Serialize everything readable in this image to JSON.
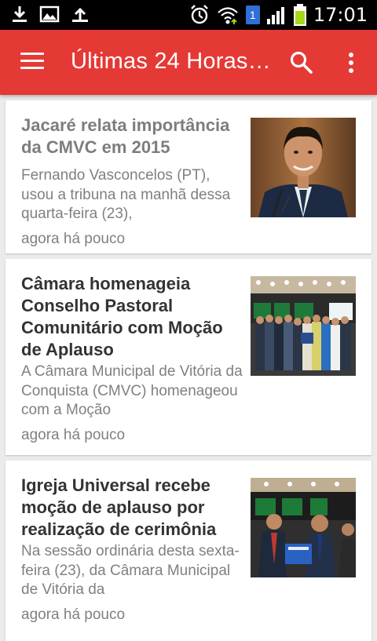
{
  "status_bar": {
    "time": "17:01",
    "notification_count": "1",
    "icons": [
      "download-icon",
      "image-icon",
      "upload-icon",
      "alarm-icon",
      "wifi-icon",
      "signal-icon",
      "battery-icon"
    ],
    "battery_color": "#a5d81c"
  },
  "app_bar": {
    "title": "Últimas 24 Horas…",
    "color": "#e53935",
    "menu_icon": "hamburger-menu-icon",
    "search_icon": "search-icon",
    "overflow_icon": "more-vert-icon"
  },
  "news": [
    {
      "title": "Jacaré relata importância da CMVC em 2015",
      "summary": "Fernando Vasconcelos (PT), usou a tribuna na manhã dessa quarta-feira (23),",
      "time": "agora há pouco",
      "read": true
    },
    {
      "title": "Câmara homenageia Conselho Pastoral Comunitário com Moção de Aplauso",
      "summary": "A Câmara Municipal de Vitória da Conquista (CMVC) homenageou com a Moção",
      "time": "agora há pouco",
      "read": false
    },
    {
      "title": "Igreja Universal recebe moção de aplauso por realização de cerimônia",
      "summary": "Na sessão ordinária desta sexta-feira (23), da Câmara Municipal de Vitória da",
      "time": "agora há pouco",
      "read": false
    }
  ]
}
